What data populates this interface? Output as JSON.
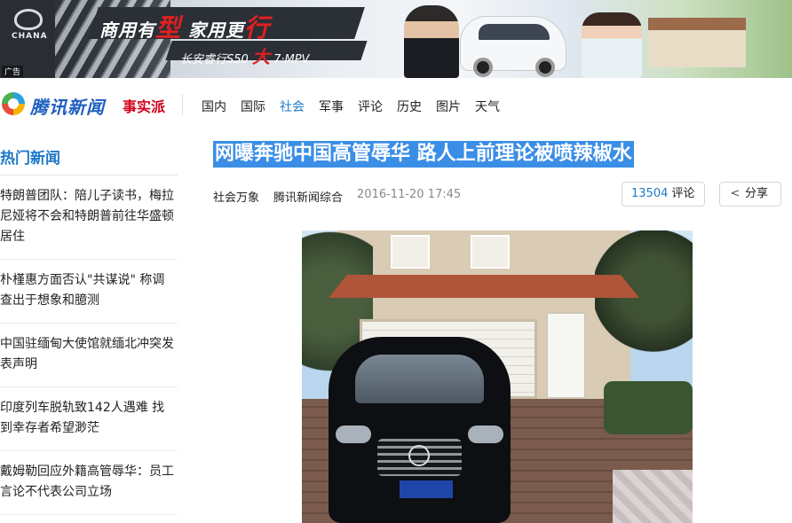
{
  "ad": {
    "tag": "广告",
    "brand": "CHANA",
    "slogan_a": "商用有",
    "slogan_b": "型",
    "slogan_c": " 家用更",
    "slogan_d": "行",
    "model_a": "长安睿行S50 ",
    "model_b": "大",
    "model_c": " 7·MPV"
  },
  "nav": {
    "site_name": "腾讯新闻",
    "sub_brand": "事实派",
    "links": [
      {
        "label": "国内",
        "active": false
      },
      {
        "label": "国际",
        "active": false
      },
      {
        "label": "社会",
        "active": true
      },
      {
        "label": "军事",
        "active": false
      },
      {
        "label": "评论",
        "active": false
      },
      {
        "label": "历史",
        "active": false
      },
      {
        "label": "图片",
        "active": false
      },
      {
        "label": "天气",
        "active": false
      }
    ],
    "active_color": "#1f78c8"
  },
  "sidebar": {
    "title": "热门新闻",
    "items": [
      {
        "label": "特朗普团队：陪儿子读书，梅拉尼娅将不会和特朗普前往华盛顿居住"
      },
      {
        "label": "朴槿惠方面否认\"共谋说\" 称调查出于想象和臆测"
      },
      {
        "label": "中国驻缅甸大使馆就缅北冲突发表声明"
      },
      {
        "label": "印度列车脱轨致142人遇难 找到幸存者希望渺茫"
      },
      {
        "label": "戴姆勒回应外籍高管辱华：员工言论不代表公司立场"
      }
    ]
  },
  "article": {
    "headline": "网曝奔驰中国高管辱华 路人上前理论被喷辣椒水",
    "category": "社会万象",
    "source": "腾讯新闻综合",
    "time": "2016-11-20 17:45",
    "comment_count": "13504",
    "comment_label": "评论",
    "share_label": "分享",
    "selection_color": "#3a8ee6"
  }
}
